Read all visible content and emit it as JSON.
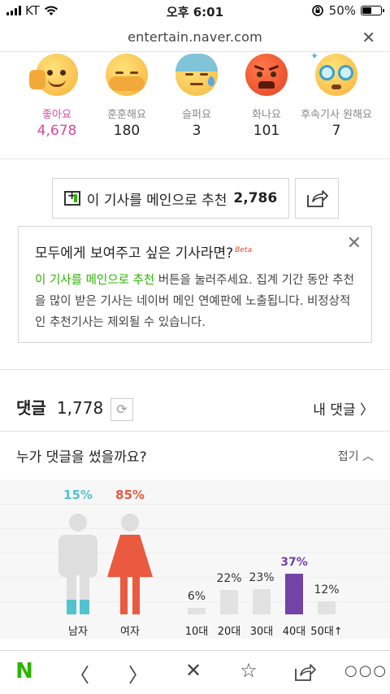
{
  "status": {
    "carrier": "KT",
    "time": "오후 6:01",
    "battery": "50%"
  },
  "urlbar": {
    "url": "entertain.naver.com"
  },
  "reactions": [
    {
      "label": "좋아요",
      "count": "4,678",
      "icon": "like-face-icon"
    },
    {
      "label": "훈훈해요",
      "count": "180",
      "icon": "warm-face-icon"
    },
    {
      "label": "슬퍼요",
      "count": "3",
      "icon": "sad-face-icon"
    },
    {
      "label": "화나요",
      "count": "101",
      "icon": "angry-face-icon"
    },
    {
      "label": "후속기사 원해요",
      "count": "7",
      "icon": "glasses-face-icon"
    }
  ],
  "recommend": {
    "label": "이 기사를 메인으로 추천",
    "count": "2,786"
  },
  "infobox": {
    "title": "모두에게 보여주고 싶은 기사라면?",
    "beta": "Beta",
    "highlight": "이 기사를 메인으로 추천",
    "desc": " 버튼을 눌러주세요. 집계 기간 동안 추천을 많이 받은 기사는 네이버 메인 연예판에 노출됩니다. 비정상적인 추천기사는 제외될 수 있습니다."
  },
  "comments": {
    "title": "댓글",
    "count": "1,778",
    "my_comments": "내 댓글"
  },
  "who": {
    "title": "누가 댓글을 썼을까요?",
    "fold": "접기"
  },
  "gender": {
    "male": {
      "label": "남자",
      "pct": "15%",
      "value": 15
    },
    "female": {
      "label": "여자",
      "pct": "85%",
      "value": 85
    }
  },
  "ages": [
    {
      "label": "10대",
      "pct": "6%",
      "value": 6
    },
    {
      "label": "20대",
      "pct": "22%",
      "value": 22
    },
    {
      "label": "30대",
      "pct": "23%",
      "value": 23
    },
    {
      "label": "40대",
      "pct": "37%",
      "value": 37,
      "highlight": true
    },
    {
      "label": "50대↑",
      "pct": "12%",
      "value": 12
    }
  ],
  "colors": {
    "male": "#52c2cf",
    "female": "#ea5a3f",
    "age_highlight": "#7443a8",
    "naver_green": "#2db400"
  }
}
